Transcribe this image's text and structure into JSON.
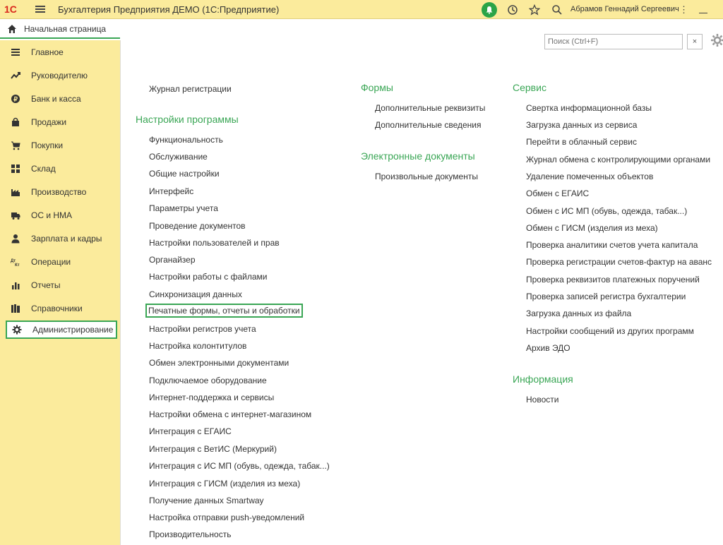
{
  "app": {
    "logo_text": "1С",
    "title": "Бухгалтерия Предприятия ДЕМО  (1С:Предприятие)",
    "user": "Абрамов Геннадий Сергеевич"
  },
  "home_tab": {
    "label": "Начальная страница"
  },
  "sidebar": {
    "items": [
      {
        "label": "Главное",
        "icon": "list-icon"
      },
      {
        "label": "Руководителю",
        "icon": "trend-icon"
      },
      {
        "label": "Банк и касса",
        "icon": "coin-icon"
      },
      {
        "label": "Продажи",
        "icon": "bag-icon"
      },
      {
        "label": "Покупки",
        "icon": "cart-icon"
      },
      {
        "label": "Склад",
        "icon": "grid-icon"
      },
      {
        "label": "Производство",
        "icon": "factory-icon"
      },
      {
        "label": "ОС и НМА",
        "icon": "truck-icon"
      },
      {
        "label": "Зарплата и кадры",
        "icon": "person-icon"
      },
      {
        "label": "Операции",
        "icon": "dt-kt-icon"
      },
      {
        "label": "Отчеты",
        "icon": "bar-chart-icon"
      },
      {
        "label": "Справочники",
        "icon": "books-icon"
      },
      {
        "label": "Администрирование",
        "icon": "gear-icon"
      }
    ]
  },
  "search": {
    "placeholder": "Поиск (Ctrl+F)",
    "clear": "×"
  },
  "columns": {
    "col1": {
      "top_link": "Журнал регистрации",
      "section": "Настройки программы",
      "links": [
        "Функциональность",
        "Обслуживание",
        "Общие настройки",
        "Интерфейс",
        "Параметры учета",
        "Проведение документов",
        "Настройки пользователей и прав",
        "Органайзер",
        "Настройки работы с файлами",
        "Синхронизация данных",
        "Печатные формы, отчеты и обработки",
        "Настройки регистров учета",
        "Настройка колонтитулов",
        "Обмен электронными документами",
        "Подключаемое оборудование",
        "Интернет-поддержка и сервисы",
        "Настройки обмена с интернет-магазином",
        "Интеграция с ЕГАИС",
        "Интеграция с ВетИС (Меркурий)",
        "Интеграция с ИС МП (обувь, одежда, табак...)",
        "Интеграция с ГИСМ (изделия из меха)",
        "Получение данных Smartway",
        "Настройка отправки push-уведомлений",
        "Производительность"
      ]
    },
    "col2": {
      "section1": "Формы",
      "links1": [
        "Дополнительные реквизиты",
        "Дополнительные сведения"
      ],
      "section2": "Электронные документы",
      "links2": [
        "Произвольные документы"
      ]
    },
    "col3": {
      "section1": "Сервис",
      "links1": [
        "Свертка информационной базы",
        "Загрузка данных из сервиса",
        "Перейти в облачный сервис",
        "Журнал обмена с контролирующими органами",
        "Удаление помеченных объектов",
        "Обмен с ЕГАИС",
        "Обмен с ИС МП (обувь, одежда, табак...)",
        "Обмен с ГИСМ (изделия из меха)",
        "Проверка аналитики счетов учета капитала",
        "Проверка регистрации счетов-фактур на аванс",
        "Проверка реквизитов платежных поручений",
        "Проверка записей регистра бухгалтерии",
        "Загрузка данных из файла",
        "Настройки сообщений из других программ",
        "Архив ЭДО"
      ],
      "section2": "Информация",
      "links2": [
        "Новости"
      ]
    }
  },
  "colors": {
    "accent": "#3aa655",
    "panel": "#fbeb9c",
    "logo_red": "#d9261c"
  }
}
